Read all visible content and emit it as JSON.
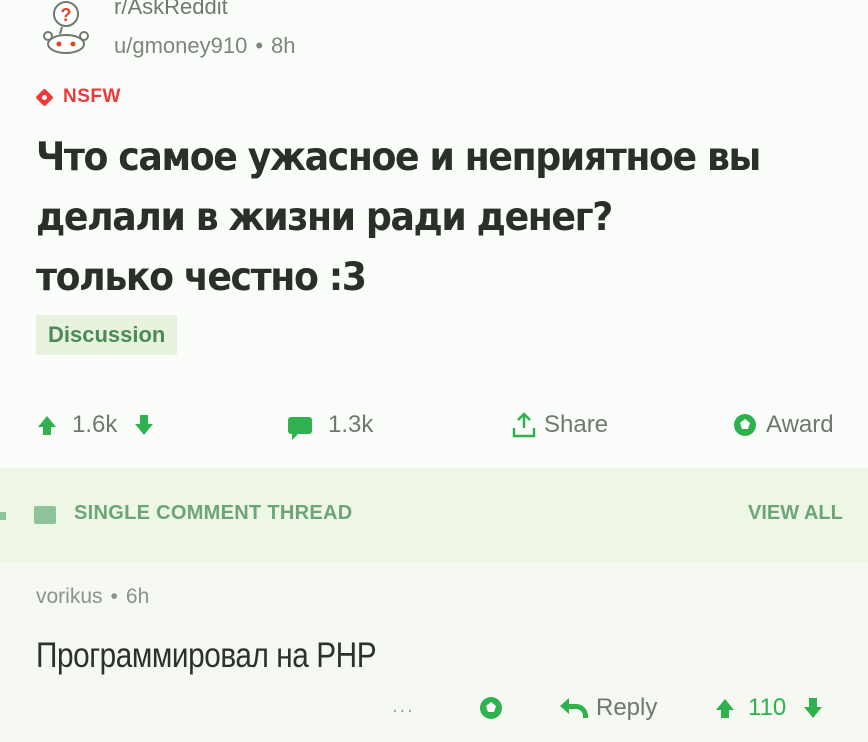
{
  "post": {
    "subreddit": "r/AskReddit",
    "author": "u/gmoney910",
    "separator": "•",
    "time": "8h",
    "nsfw_label": "NSFW",
    "title_lines": [
      "Что самое ужасное и неприятное вы",
      "делали в жизни ради денег?",
      "только честно :3"
    ],
    "flair": "Discussion"
  },
  "actions": {
    "upvotes": "1.6k",
    "comments": "1.3k",
    "share": "Share",
    "award": "Award"
  },
  "thread": {
    "label": "SINGLE COMMENT THREAD",
    "view_all": "VIEW ALL"
  },
  "comment": {
    "author": "vorikus",
    "separator": "•",
    "time": "6h",
    "body": "Программировал на PHP",
    "more": "...",
    "reply": "Reply",
    "score": "110"
  },
  "colors": {
    "accent_green": "#2fb24e",
    "nsfw_red": "#ec3a3a",
    "banner_bg": "#eef6e6"
  }
}
